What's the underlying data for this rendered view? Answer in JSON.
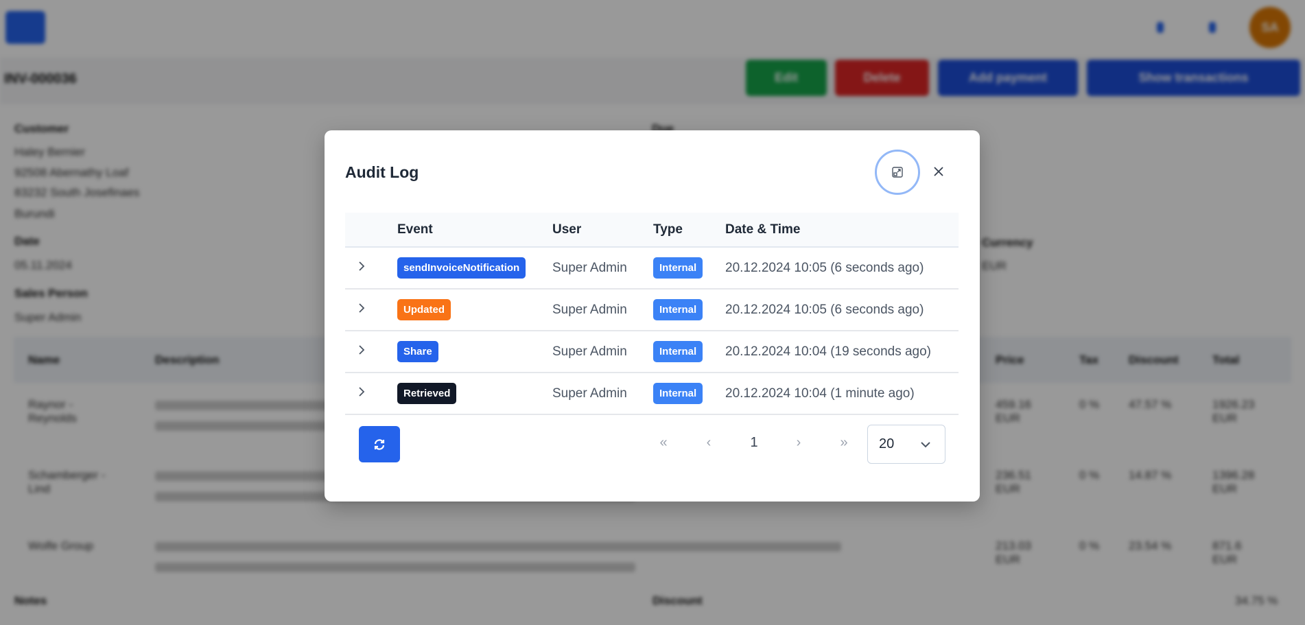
{
  "background": {
    "avatar_initials": "SA",
    "invoice_title": "INV-000036",
    "buttons": {
      "edit": "Edit",
      "delete": "Delete",
      "add_payment": "Add payment",
      "show_transactions": "Show transactions"
    },
    "customer_label": "Customer",
    "customer_lines": [
      "Haley Bernier",
      "92508 Abernathy Loaf",
      "83232 South Josefinaes",
      "Burundi"
    ],
    "date_label": "Date",
    "date_value": "05.11.2024",
    "sales_person_label": "Sales Person",
    "sales_person_value": "Super Admin",
    "due_label": "Due",
    "currency_label": "Currency",
    "currency_value": "EUR",
    "table_headers": [
      "Name",
      "Description",
      "Price",
      "Tax",
      "Discount",
      "Total"
    ],
    "rows": [
      {
        "name": "Raynor - Reynolds",
        "price": "459.16 EUR",
        "tax": "0 %",
        "discount": "47.57 %",
        "total": "1926.23 EUR"
      },
      {
        "name": "Schamberger - Lind",
        "price": "236.51 EUR",
        "tax": "0 %",
        "discount": "14.87 %",
        "total": "1396.28 EUR"
      },
      {
        "name": "Wolfe Group",
        "price": "213.03 EUR",
        "tax": "0 %",
        "discount": "23.54 %",
        "total": "871.6 EUR"
      }
    ],
    "notes_label": "Notes",
    "discount_label": "Discount",
    "discount_value": "34.75 %"
  },
  "modal": {
    "title": "Audit Log",
    "columns": [
      "Event",
      "User",
      "Type",
      "Date & Time"
    ],
    "rows": [
      {
        "event": "sendInvoiceNotification",
        "event_color": "#2563eb",
        "user": "Super Admin",
        "type": "Internal",
        "datetime": "20.12.2024 10:05 (6 seconds ago)"
      },
      {
        "event": "Updated",
        "event_color": "#f97316",
        "user": "Super Admin",
        "type": "Internal",
        "datetime": "20.12.2024 10:05 (6 seconds ago)"
      },
      {
        "event": "Share",
        "event_color": "#2563eb",
        "user": "Super Admin",
        "type": "Internal",
        "datetime": "20.12.2024 10:04 (19 seconds ago)"
      },
      {
        "event": "Retrieved",
        "event_color": "#111827",
        "user": "Super Admin",
        "type": "Internal",
        "datetime": "20.12.2024 10:04 (1 minute ago)"
      }
    ],
    "type_color": "#3b82f6",
    "pagination": {
      "first": "«",
      "prev": "‹",
      "page": "1",
      "next": "›",
      "last": "»",
      "per_page": "20"
    }
  }
}
